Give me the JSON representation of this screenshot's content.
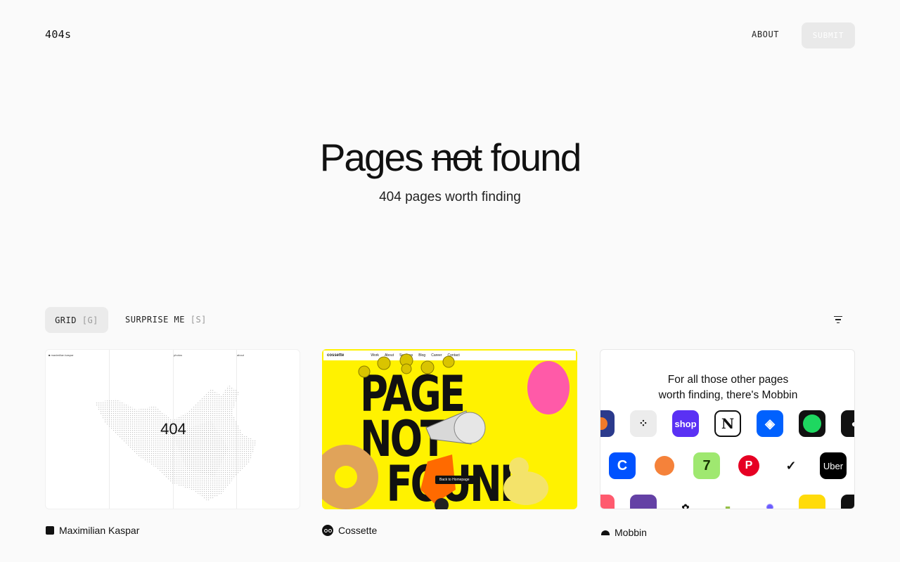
{
  "header": {
    "logo": "404s",
    "about_label": "ABOUT",
    "submit_label": "SUBMIT"
  },
  "hero": {
    "title_pre": "Pages",
    "title_strike": "not",
    "title_post": "found",
    "subtitle": "404 pages worth finding"
  },
  "toolbar": {
    "grid_label": "GRID",
    "grid_key": "[G]",
    "surprise_label": "SURPRISE ME",
    "surprise_key": "[S]",
    "filter_icon": "filter-icon"
  },
  "cards": [
    {
      "name": "Maximilian Kaspar",
      "preview": {
        "brand": "maximilian kaspar",
        "col2": "photos",
        "col3": "about",
        "center_text": "404"
      }
    },
    {
      "name": "Cossette",
      "preview": {
        "brand": "cossette",
        "nav": [
          "Work",
          "About",
          "Services",
          "Blog",
          "Career",
          "Contact"
        ],
        "headline_line1": "PAGE NOT",
        "headline_line2": "FOUND",
        "back_button": "Back to Homepage"
      }
    },
    {
      "name": "Mobbin",
      "preview": {
        "message_line1": "For all those other pages",
        "message_line2": "worth finding, there's Mobbin",
        "apps": [
          {
            "label": "",
            "color": "#2b3a8c"
          },
          {
            "label": "",
            "color": "#ececec"
          },
          {
            "label": "shop",
            "color": "#5a31f4"
          },
          {
            "label": "N",
            "color": "#ffffff"
          },
          {
            "label": "",
            "color": "#0061fe"
          },
          {
            "label": "",
            "color": "#1ed760"
          },
          {
            "label": "",
            "color": "#111111"
          },
          {
            "label": "C",
            "color": "#0052ff"
          },
          {
            "label": "",
            "color": "#ffffff"
          },
          {
            "label": "7",
            "color": "#9fe870"
          },
          {
            "label": "P",
            "color": "#ffffff"
          },
          {
            "label": "",
            "color": "#ffffff"
          },
          {
            "label": "Uber",
            "color": "#000000"
          }
        ]
      }
    }
  ],
  "colors": {
    "background": "#fafafa",
    "cossette_yellow": "#fff200",
    "submit_bg": "#e9e9e9"
  }
}
